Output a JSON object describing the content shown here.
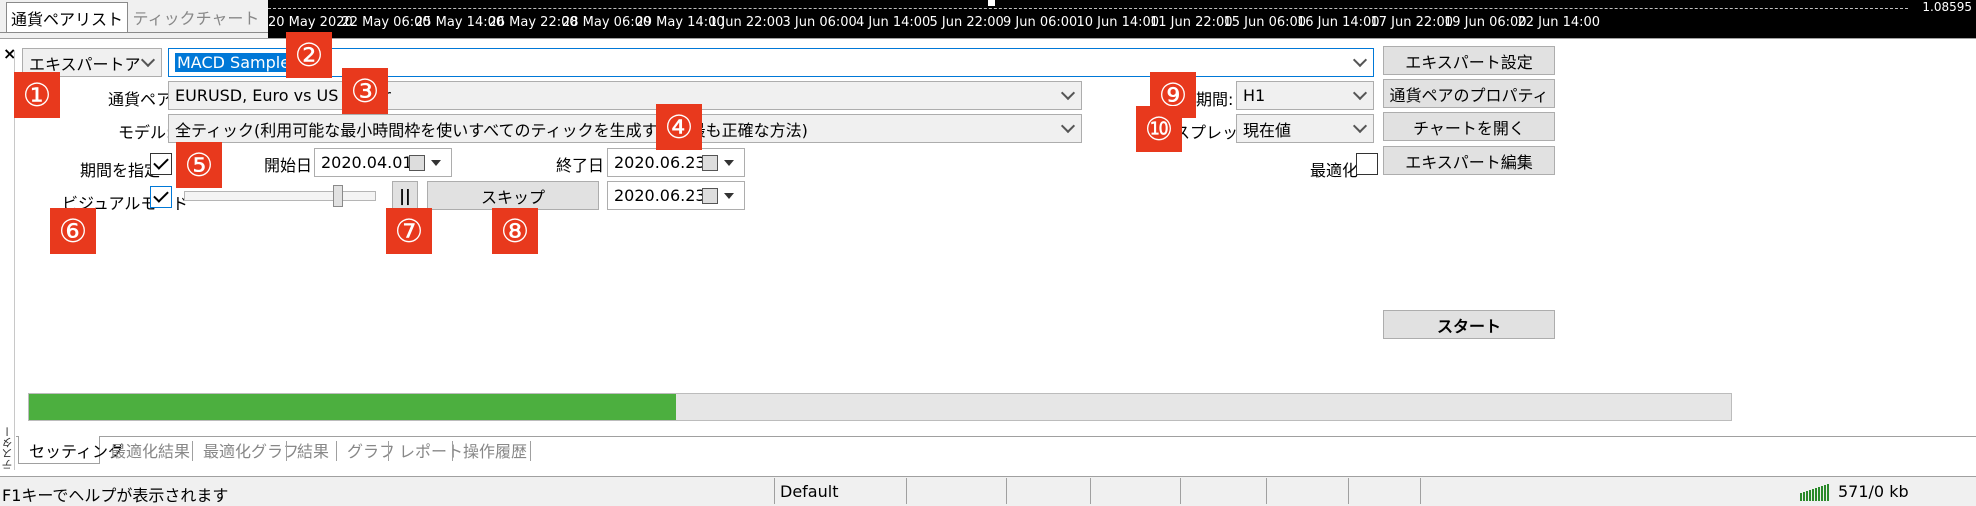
{
  "top": {
    "tab_pairlist": "通貨ペアリスト",
    "tab_tickchart": "ティックチャート",
    "chart_price": "1.08595",
    "chart_x_labels": [
      "20 May 2020",
      "22 May 06:00",
      "25 May 14:00",
      "26 May 22:00",
      "28 May 06:00",
      "29 May 14:00",
      "1 Jun 22:00",
      "3 Jun 06:00",
      "4 Jun 14:00",
      "5 Jun 22:00",
      "9 Jun 06:00",
      "10 Jun 14:00",
      "11 Jun 22:00",
      "15 Jun 06:00",
      "16 Jun 14:00",
      "17 Jun 22:00",
      "19 Jun 06:00",
      "22 Jun 14:00"
    ]
  },
  "panel": {
    "close_glyph": "×",
    "side_label": "テスター",
    "program_type": "エキスパートアドバイザ",
    "expert_file": "MACD Sample.ex4",
    "symbol_label": "通貨ペア:",
    "symbol_value": "EURUSD, Euro vs US Dollar",
    "model_label": "モデル:",
    "model_value": "全ティック(利用可能な最小時間枠を使いすべてのティックを生成する、最も正確な方法)",
    "use_date_label": "期間を指定",
    "use_date_checked": true,
    "start_label": "開始日",
    "start_value": "2020.04.01",
    "end_label": "終了日",
    "end_value": "2020.06.23",
    "visual_label": "ビジュアルモード",
    "visual_checked": true,
    "visual_speed": 0.82,
    "pause_glyph": "||",
    "skip_label": "スキップ",
    "skip_to_value": "2020.06.23",
    "period_label": "期間:",
    "period_value": "H1",
    "spread_label": "スプレッド:",
    "spread_value": "現在値",
    "optimize_label": "最適化",
    "optimize_checked": false,
    "btn_expert_settings": "エキスパート設定",
    "btn_symbol_props": "通貨ペアのプロパティ",
    "btn_open_chart": "チャートを開く",
    "btn_modify_expert": "エキスパート編集",
    "btn_start": "スタート",
    "progress": 0.38
  },
  "badges": [
    "①",
    "②",
    "③",
    "④",
    "⑤",
    "⑥",
    "⑦",
    "⑧",
    "⑨",
    "⑩"
  ],
  "bottom_tabs": [
    "セッティング",
    "最適化結果",
    "最適化グラフ",
    "結果",
    "グラフ",
    "レポート",
    "操作履歴"
  ],
  "status": {
    "help": "F1キーでヘルプが表示されます",
    "profile": "Default",
    "traffic": "571/0 kb"
  },
  "colors": {
    "badge": "#e8391d",
    "progress": "#4caf3f",
    "selection": "#0078d7"
  }
}
